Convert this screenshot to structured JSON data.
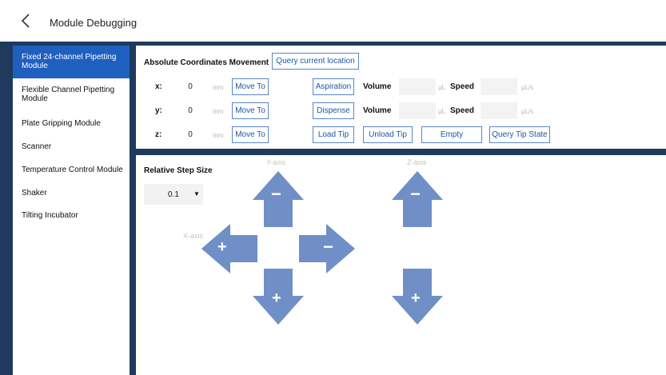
{
  "header": {
    "title": "Module Debugging",
    "back_icon": "chevron-left-icon"
  },
  "sidebar": {
    "items": [
      {
        "label": "Fixed 24-channel Pipetting Module",
        "active": true
      },
      {
        "label": "Flexible Channel Pipetting Module",
        "active": false
      },
      {
        "label": "Plate Gripping Module",
        "active": false
      },
      {
        "label": "Scanner",
        "active": false
      },
      {
        "label": "Temperature Control Module",
        "active": false
      },
      {
        "label": "Shaker",
        "active": false
      },
      {
        "label": "Tilting Incubator",
        "active": false
      }
    ]
  },
  "absolute": {
    "title": "Absolute Coordinates Movement",
    "query_location": "Query current location",
    "rows": [
      {
        "axis": "x:",
        "value": "0",
        "unit": "mm",
        "move": "Move To"
      },
      {
        "axis": "y:",
        "value": "0",
        "unit": "mm",
        "move": "Move To"
      },
      {
        "axis": "z:",
        "value": "0",
        "unit": "mm",
        "move": "Move To"
      }
    ],
    "aspiration": "Aspiration",
    "dispense": "Dispense",
    "volume_label": "Volume",
    "volume_unit": "μL",
    "speed_label": "Speed",
    "speed_unit": "μL/s",
    "load_tip": "Load Tip",
    "unload_tip": "Unload Tip",
    "empty": "Empty",
    "query_tip": "Query Tip State"
  },
  "relative": {
    "title": "Relative Step Size",
    "step_value": "0.1",
    "caret_icon": "caret-down-icon",
    "y_axis": "Y-axis",
    "z_axis": "Z-axis",
    "x_axis": "X-axis",
    "minus": "−",
    "plus": "+"
  },
  "colors": {
    "accent": "#1f5fbf",
    "band": "#1f3a5c",
    "arrow": "#6f8fc6",
    "button_border": "#5a86c6"
  }
}
